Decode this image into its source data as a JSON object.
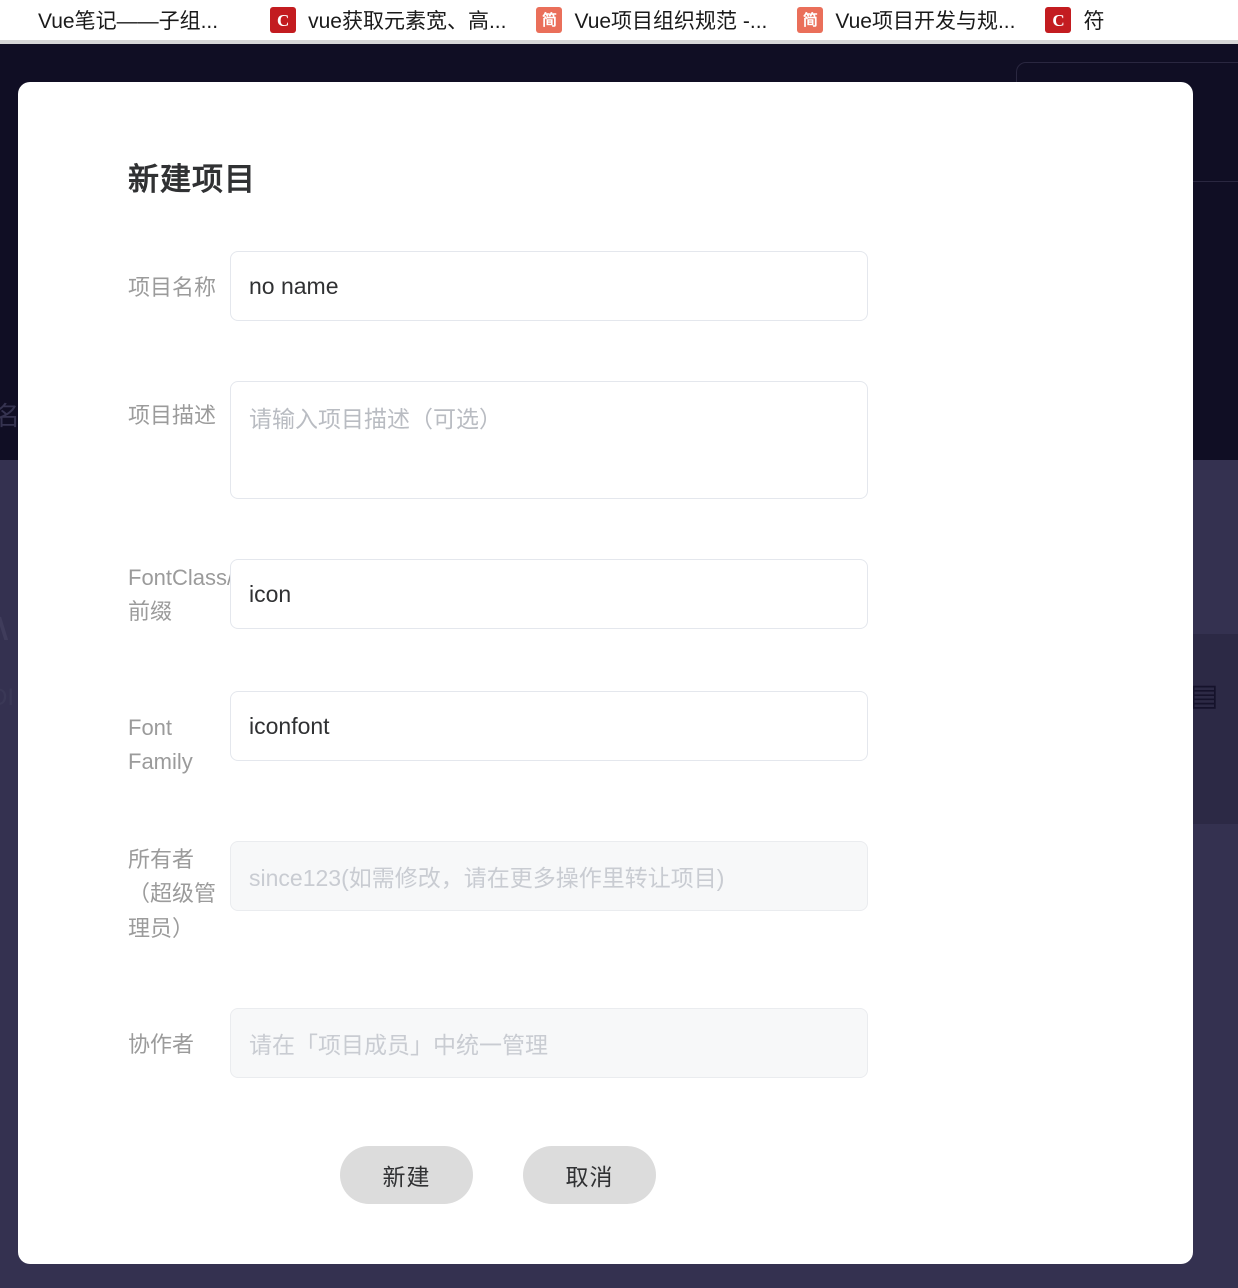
{
  "browser": {
    "tabs": [
      {
        "title": "Vue笔记——子组...",
        "favicon": "none-icon",
        "favicon_label": ""
      },
      {
        "title": "vue获取元素宽、高...",
        "favicon": "csdn-icon",
        "favicon_label": "C"
      },
      {
        "title": "Vue项目组织规范 -...",
        "favicon": "jianshu-icon",
        "favicon_label": "简"
      },
      {
        "title": "Vue项目开发与规...",
        "favicon": "jianshu-icon",
        "favicon_label": "简"
      },
      {
        "title": "符",
        "favicon": "csdn-icon",
        "favicon_label": "C"
      }
    ]
  },
  "background": {
    "ghost_a": "名",
    "ghost_b": "∧",
    "ghost_c": "DI",
    "grid_icon": "▤"
  },
  "modal": {
    "title": "新建项目",
    "fields": [
      {
        "label": "项目名称",
        "value": "no name",
        "placeholder": "",
        "disabled": false,
        "multiline": false
      },
      {
        "label": "项目描述",
        "value": "",
        "placeholder": "请输入项目描述（可选）",
        "disabled": false,
        "multiline": true
      },
      {
        "label": "FontClass/Symbol 前缀",
        "value": "icon",
        "placeholder": "",
        "disabled": false,
        "multiline": false
      },
      {
        "label": "Font Family",
        "value": "iconfont",
        "placeholder": "",
        "disabled": false,
        "multiline": false
      },
      {
        "label": "所有者（超级管理员）",
        "value": "",
        "placeholder": "since123(如需修改，请在更多操作里转让项目)",
        "disabled": true,
        "multiline": false
      },
      {
        "label": "协作者",
        "value": "",
        "placeholder": "请在「项目成员」中统一管理",
        "disabled": true,
        "multiline": false
      }
    ],
    "buttons": {
      "submit": "新建",
      "cancel": "取消"
    }
  },
  "colors": {
    "page_dark": "#100e24",
    "page_body": "#343150",
    "modal_bg": "#ffffff",
    "label": "#9b9b9b",
    "value": "#303133",
    "placeholder": "#b9bcc2",
    "button_bg": "#dcdcdc",
    "csdn_red": "#c31c20",
    "jianshu_orange": "#ea6f5a"
  }
}
